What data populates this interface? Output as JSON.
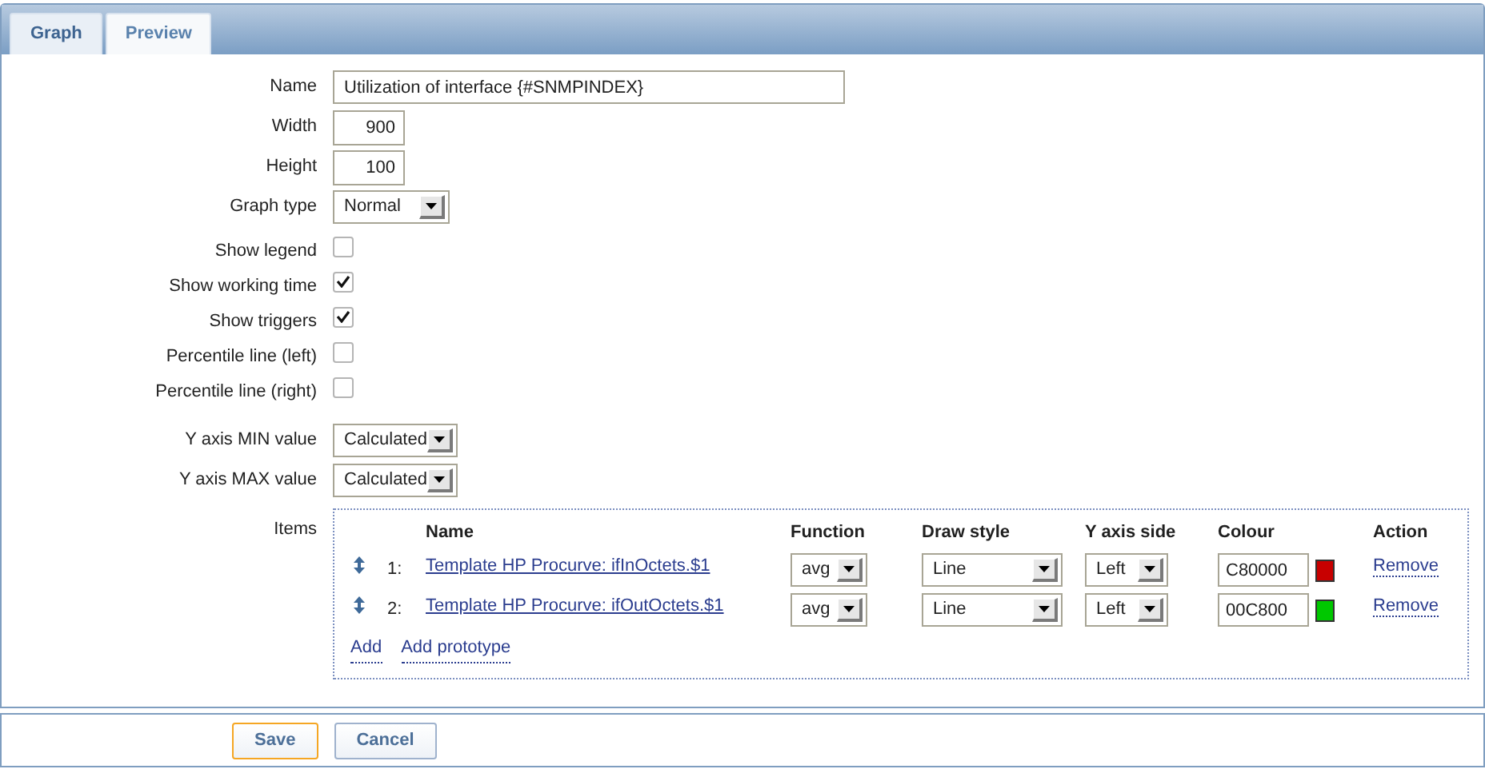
{
  "tabs": [
    {
      "label": "Graph",
      "selected": true
    },
    {
      "label": "Preview",
      "selected": false
    }
  ],
  "form": [
    {
      "kind": "text",
      "label": "Name",
      "value": "Utilization of interface {#SNMPINDEX}"
    },
    {
      "kind": "number",
      "label": "Width",
      "value": "900"
    },
    {
      "kind": "number",
      "label": "Height",
      "value": "100"
    },
    {
      "kind": "select",
      "label": "Graph type",
      "value": "Normal"
    },
    {
      "kind": "checkbox",
      "label": "Show legend",
      "checked": false
    },
    {
      "kind": "checkbox",
      "label": "Show working time",
      "checked": true
    },
    {
      "kind": "checkbox",
      "label": "Show triggers",
      "checked": true
    },
    {
      "kind": "checkbox",
      "label": "Percentile line (left)",
      "checked": false
    },
    {
      "kind": "checkbox",
      "label": "Percentile line (right)",
      "checked": false
    },
    {
      "kind": "select",
      "label": "Y axis MIN value",
      "value": "Calculated"
    },
    {
      "kind": "select",
      "label": "Y axis MAX value",
      "value": "Calculated"
    }
  ],
  "items": {
    "label": "Items",
    "columns": [
      "Name",
      "Function",
      "Draw style",
      "Y axis side",
      "Colour",
      "Action"
    ],
    "rows": [
      {
        "number": "1:",
        "name": "Template HP Procurve: ifInOctets.$1",
        "function": "avg",
        "draw_style": "Line",
        "y_axis_side": "Left",
        "colour": "C80000",
        "color": "#c80000",
        "action": "Remove"
      },
      {
        "number": "2:",
        "name": "Template HP Procurve: ifOutOctets.$1",
        "function": "avg",
        "draw_style": "Line",
        "y_axis_side": "Left",
        "colour": "00C800",
        "color": "#00c800",
        "action": "Remove"
      }
    ],
    "links": [
      "Add",
      "Add prototype"
    ]
  },
  "buttons": [
    {
      "label": "Save",
      "kind": "primary"
    },
    {
      "label": "Cancel",
      "kind": "secondary"
    }
  ]
}
